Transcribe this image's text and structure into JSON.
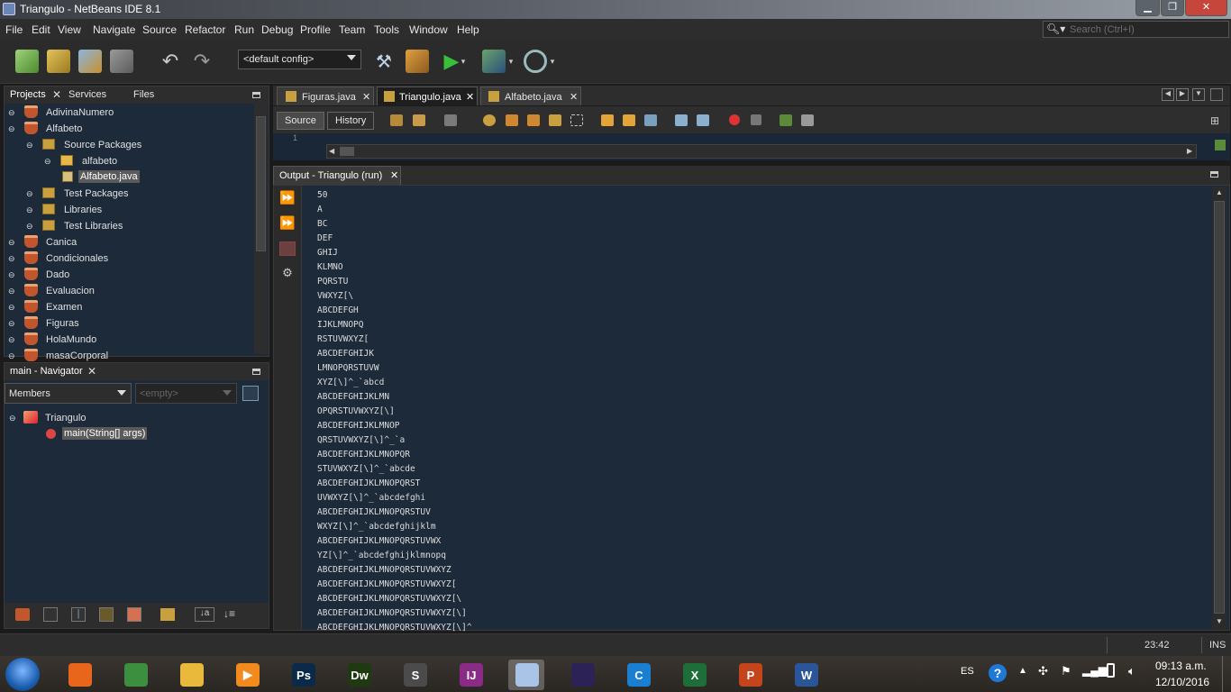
{
  "window": {
    "title": "Triangulo - NetBeans IDE 8.1",
    "min": "▁",
    "max": "❐",
    "close": "✕"
  },
  "menu": [
    "File",
    "Edit",
    "View",
    "Navigate",
    "Source",
    "Refactor",
    "Run",
    "Debug",
    "Profile",
    "Team",
    "Tools",
    "Window",
    "Help"
  ],
  "search": {
    "placeholder": "Search (Ctrl+I)"
  },
  "toolbar": {
    "config": "<default config>"
  },
  "projects_panel": {
    "tabs": [
      "Projects",
      "Services",
      "Files"
    ],
    "tree": [
      {
        "label": "AdivinaNumero",
        "kind": "project",
        "depth": 0
      },
      {
        "label": "Alfabeto",
        "kind": "project",
        "depth": 0
      },
      {
        "label": "Source Packages",
        "kind": "folder",
        "depth": 1
      },
      {
        "label": "alfabeto",
        "kind": "package",
        "depth": 2
      },
      {
        "label": "Alfabeto.java",
        "kind": "file",
        "depth": 3,
        "selected": true
      },
      {
        "label": "Test Packages",
        "kind": "folder",
        "depth": 1
      },
      {
        "label": "Libraries",
        "kind": "folder",
        "depth": 1
      },
      {
        "label": "Test Libraries",
        "kind": "folder",
        "depth": 1
      },
      {
        "label": "Canica",
        "kind": "project",
        "depth": 0
      },
      {
        "label": "Condicionales",
        "kind": "project",
        "depth": 0
      },
      {
        "label": "Dado",
        "kind": "project",
        "depth": 0
      },
      {
        "label": "Evaluacion",
        "kind": "project",
        "depth": 0
      },
      {
        "label": "Examen",
        "kind": "project",
        "depth": 0
      },
      {
        "label": "Figuras",
        "kind": "project",
        "depth": 0
      },
      {
        "label": "HolaMundo",
        "kind": "project",
        "depth": 0
      },
      {
        "label": "masaCorporal",
        "kind": "project",
        "depth": 0
      }
    ]
  },
  "navigator": {
    "title": "main - Navigator",
    "members": "Members",
    "empty": "<empty>",
    "class_name": "Triangulo",
    "method": "main(String[] args)"
  },
  "editor": {
    "tabs": [
      "Figuras.java",
      "Triangulo.java",
      "Alfabeto.java"
    ],
    "active_tab": 1,
    "source_label": "Source",
    "history_label": "History",
    "line_no": "1"
  },
  "output": {
    "title": "Output - Triangulo (run)",
    "lines": [
      "50",
      "A",
      "BC",
      "DEF",
      "GHIJ",
      "KLMNO",
      "PQRSTU",
      "VWXYZ[\\",
      "ABCDEFGH",
      "IJKLMNOPQ",
      "RSTUVWXYZ[",
      "ABCDEFGHIJK",
      "LMNOPQRSTUVW",
      "XYZ[\\]^_`abcd",
      "ABCDEFGHIJKLMN",
      "OPQRSTUVWXYZ[\\]",
      "ABCDEFGHIJKLMNOP",
      "QRSTUVWXYZ[\\]^_`a",
      "ABCDEFGHIJKLMNOPQR",
      "STUVWXYZ[\\]^_`abcde",
      "ABCDEFGHIJKLMNOPQRST",
      "UVWXYZ[\\]^_`abcdefghi",
      "ABCDEFGHIJKLMNOPQRSTUV",
      "WXYZ[\\]^_`abcdefghijklm",
      "ABCDEFGHIJKLMNOPQRSTUVWX",
      "YZ[\\]^_`abcdefghijklmnopq",
      "ABCDEFGHIJKLMNOPQRSTUVWXYZ",
      "ABCDEFGHIJKLMNOPQRSTUVWXYZ[",
      "ABCDEFGHIJKLMNOPQRSTUVWXYZ[\\",
      "ABCDEFGHIJKLMNOPQRSTUVWXYZ[\\]",
      "ABCDEFGHIJKLMNOPQRSTUVWXYZ[\\]^"
    ]
  },
  "status": {
    "position": "23:42",
    "mode": "INS"
  },
  "taskbar": {
    "apps": [
      {
        "name": "firefox",
        "glyph": "",
        "color": "#e8661c"
      },
      {
        "name": "chrome",
        "glyph": "",
        "color": "#3b8f3e"
      },
      {
        "name": "explorer",
        "glyph": "",
        "color": "#e8b93a"
      },
      {
        "name": "media",
        "glyph": "▶",
        "color": "#f28a1e"
      },
      {
        "name": "photoshop",
        "glyph": "Ps",
        "color": "#0b2a4a"
      },
      {
        "name": "dreamweaver",
        "glyph": "Dw",
        "color": "#1f3a10"
      },
      {
        "name": "sublime",
        "glyph": "S",
        "color": "#4b4b4b"
      },
      {
        "name": "intellij",
        "glyph": "IJ",
        "color": "#8a2b86"
      },
      {
        "name": "netbeans",
        "glyph": "",
        "color": "#a9c4e6"
      },
      {
        "name": "eclipse",
        "glyph": "",
        "color": "#2c2255"
      },
      {
        "name": "ccleaner",
        "glyph": "C",
        "color": "#1a7fd1"
      },
      {
        "name": "excel",
        "glyph": "X",
        "color": "#1e6e3a"
      },
      {
        "name": "powerpoint",
        "glyph": "P",
        "color": "#c4451c"
      },
      {
        "name": "word",
        "glyph": "W",
        "color": "#2a5699"
      }
    ],
    "lang": "ES",
    "time": "09:13 a.m.",
    "date": "12/10/2016"
  },
  "colors": {
    "accent": "#2d2d2d",
    "output_bg": "#1c2a3a"
  }
}
